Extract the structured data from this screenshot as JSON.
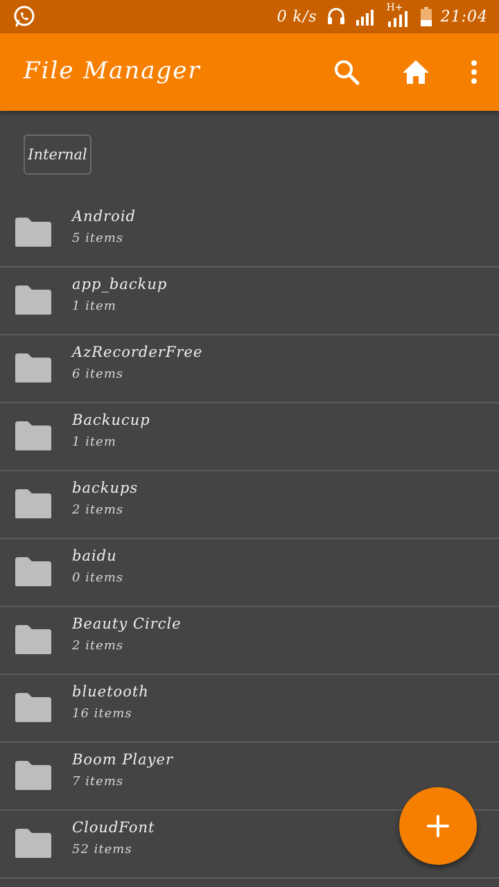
{
  "status_bar": {
    "speed": "0 k/s",
    "network": "H+",
    "time": "21:04"
  },
  "app_bar": {
    "title": "File Manager"
  },
  "storage": {
    "label": "Internal"
  },
  "folders": [
    {
      "name": "Android",
      "count": "5 items"
    },
    {
      "name": "app_backup",
      "count": "1 item"
    },
    {
      "name": "AzRecorderFree",
      "count": "6 items"
    },
    {
      "name": "Backucup",
      "count": "1 item"
    },
    {
      "name": "backups",
      "count": "2 items"
    },
    {
      "name": "baidu",
      "count": "0 items"
    },
    {
      "name": "Beauty Circle",
      "count": "2 items"
    },
    {
      "name": "bluetooth",
      "count": "16 items"
    },
    {
      "name": "Boom Player",
      "count": "7 items"
    },
    {
      "name": "CloudFont",
      "count": "52 items"
    }
  ],
  "colors": {
    "accent": "#F77F00",
    "status_bar": "#C96000",
    "background": "#444444",
    "folder_icon": "#BDBDBD"
  }
}
